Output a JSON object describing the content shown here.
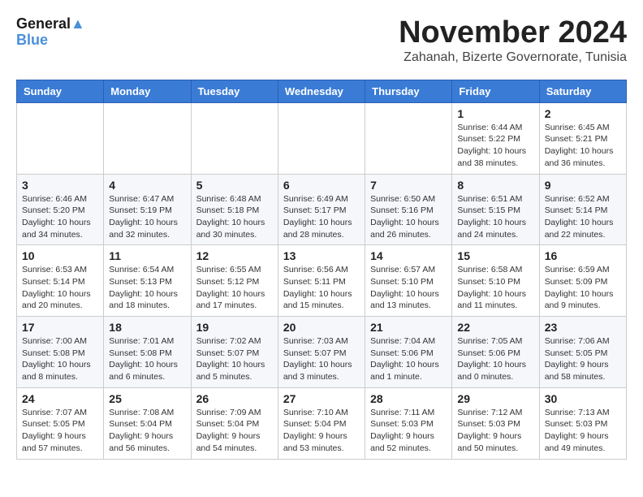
{
  "header": {
    "logo_line1": "General",
    "logo_line2": "Blue",
    "month_title": "November 2024",
    "location": "Zahanah, Bizerte Governorate, Tunisia"
  },
  "calendar": {
    "days_of_week": [
      "Sunday",
      "Monday",
      "Tuesday",
      "Wednesday",
      "Thursday",
      "Friday",
      "Saturday"
    ],
    "weeks": [
      [
        {
          "day": "",
          "info": ""
        },
        {
          "day": "",
          "info": ""
        },
        {
          "day": "",
          "info": ""
        },
        {
          "day": "",
          "info": ""
        },
        {
          "day": "",
          "info": ""
        },
        {
          "day": "1",
          "info": "Sunrise: 6:44 AM\nSunset: 5:22 PM\nDaylight: 10 hours and 38 minutes."
        },
        {
          "day": "2",
          "info": "Sunrise: 6:45 AM\nSunset: 5:21 PM\nDaylight: 10 hours and 36 minutes."
        }
      ],
      [
        {
          "day": "3",
          "info": "Sunrise: 6:46 AM\nSunset: 5:20 PM\nDaylight: 10 hours and 34 minutes."
        },
        {
          "day": "4",
          "info": "Sunrise: 6:47 AM\nSunset: 5:19 PM\nDaylight: 10 hours and 32 minutes."
        },
        {
          "day": "5",
          "info": "Sunrise: 6:48 AM\nSunset: 5:18 PM\nDaylight: 10 hours and 30 minutes."
        },
        {
          "day": "6",
          "info": "Sunrise: 6:49 AM\nSunset: 5:17 PM\nDaylight: 10 hours and 28 minutes."
        },
        {
          "day": "7",
          "info": "Sunrise: 6:50 AM\nSunset: 5:16 PM\nDaylight: 10 hours and 26 minutes."
        },
        {
          "day": "8",
          "info": "Sunrise: 6:51 AM\nSunset: 5:15 PM\nDaylight: 10 hours and 24 minutes."
        },
        {
          "day": "9",
          "info": "Sunrise: 6:52 AM\nSunset: 5:14 PM\nDaylight: 10 hours and 22 minutes."
        }
      ],
      [
        {
          "day": "10",
          "info": "Sunrise: 6:53 AM\nSunset: 5:14 PM\nDaylight: 10 hours and 20 minutes."
        },
        {
          "day": "11",
          "info": "Sunrise: 6:54 AM\nSunset: 5:13 PM\nDaylight: 10 hours and 18 minutes."
        },
        {
          "day": "12",
          "info": "Sunrise: 6:55 AM\nSunset: 5:12 PM\nDaylight: 10 hours and 17 minutes."
        },
        {
          "day": "13",
          "info": "Sunrise: 6:56 AM\nSunset: 5:11 PM\nDaylight: 10 hours and 15 minutes."
        },
        {
          "day": "14",
          "info": "Sunrise: 6:57 AM\nSunset: 5:10 PM\nDaylight: 10 hours and 13 minutes."
        },
        {
          "day": "15",
          "info": "Sunrise: 6:58 AM\nSunset: 5:10 PM\nDaylight: 10 hours and 11 minutes."
        },
        {
          "day": "16",
          "info": "Sunrise: 6:59 AM\nSunset: 5:09 PM\nDaylight: 10 hours and 9 minutes."
        }
      ],
      [
        {
          "day": "17",
          "info": "Sunrise: 7:00 AM\nSunset: 5:08 PM\nDaylight: 10 hours and 8 minutes."
        },
        {
          "day": "18",
          "info": "Sunrise: 7:01 AM\nSunset: 5:08 PM\nDaylight: 10 hours and 6 minutes."
        },
        {
          "day": "19",
          "info": "Sunrise: 7:02 AM\nSunset: 5:07 PM\nDaylight: 10 hours and 5 minutes."
        },
        {
          "day": "20",
          "info": "Sunrise: 7:03 AM\nSunset: 5:07 PM\nDaylight: 10 hours and 3 minutes."
        },
        {
          "day": "21",
          "info": "Sunrise: 7:04 AM\nSunset: 5:06 PM\nDaylight: 10 hours and 1 minute."
        },
        {
          "day": "22",
          "info": "Sunrise: 7:05 AM\nSunset: 5:06 PM\nDaylight: 10 hours and 0 minutes."
        },
        {
          "day": "23",
          "info": "Sunrise: 7:06 AM\nSunset: 5:05 PM\nDaylight: 9 hours and 58 minutes."
        }
      ],
      [
        {
          "day": "24",
          "info": "Sunrise: 7:07 AM\nSunset: 5:05 PM\nDaylight: 9 hours and 57 minutes."
        },
        {
          "day": "25",
          "info": "Sunrise: 7:08 AM\nSunset: 5:04 PM\nDaylight: 9 hours and 56 minutes."
        },
        {
          "day": "26",
          "info": "Sunrise: 7:09 AM\nSunset: 5:04 PM\nDaylight: 9 hours and 54 minutes."
        },
        {
          "day": "27",
          "info": "Sunrise: 7:10 AM\nSunset: 5:04 PM\nDaylight: 9 hours and 53 minutes."
        },
        {
          "day": "28",
          "info": "Sunrise: 7:11 AM\nSunset: 5:03 PM\nDaylight: 9 hours and 52 minutes."
        },
        {
          "day": "29",
          "info": "Sunrise: 7:12 AM\nSunset: 5:03 PM\nDaylight: 9 hours and 50 minutes."
        },
        {
          "day": "30",
          "info": "Sunrise: 7:13 AM\nSunset: 5:03 PM\nDaylight: 9 hours and 49 minutes."
        }
      ]
    ]
  }
}
